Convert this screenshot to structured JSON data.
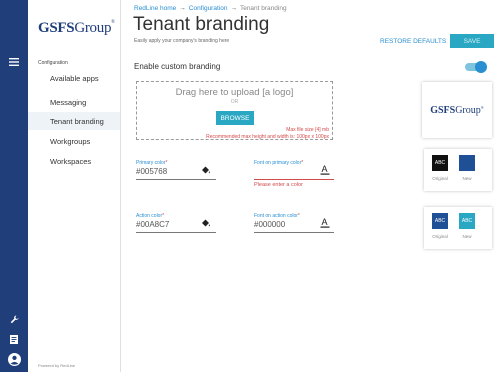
{
  "brand": {
    "logo_main": "GSFS",
    "logo_tail": "Group",
    "logo_mark": "®"
  },
  "nav": {
    "section": "Configuration",
    "items": [
      {
        "label": "Available apps",
        "active": false
      },
      {
        "label": "Messaging",
        "active": false
      },
      {
        "label": "Tenant branding",
        "active": true
      },
      {
        "label": "Workgroups",
        "active": false
      },
      {
        "label": "Workspaces",
        "active": false
      }
    ],
    "footer": "Powered by RedLine"
  },
  "breadcrumb": {
    "home": "RedLine home",
    "sep1": "→",
    "section": "Configuration",
    "sep2": "→",
    "current": "Tenant branding"
  },
  "header": {
    "title": "Tenant branding",
    "subtitle": "Easily apply your company's branding here",
    "restore_label": "RESTORE DEFAULTS",
    "save_label": "SAVE"
  },
  "enable": {
    "label": "Enable custom branding",
    "on": true
  },
  "upload": {
    "drag_text": "Drag here to upload [a logo]",
    "or_text": "OR",
    "browse_label": "BROWSE",
    "max_size": "Max file size [4] mb",
    "recommend": "Recommended max height and width is: 100px x 100px"
  },
  "fields": {
    "primary_color": {
      "label": "Primary color",
      "req": "*",
      "value": "#005768"
    },
    "font_on_primary": {
      "label": "Font on primary color",
      "req": "*",
      "value": "",
      "error": "Please enter a color"
    },
    "action_color": {
      "label": "Action color",
      "req": "*",
      "value": "#00A8C7"
    },
    "font_on_action": {
      "label": "Font on action color",
      "req": "*",
      "value": "#000000"
    }
  },
  "previews": {
    "primary": {
      "abc": "ABC",
      "original_label": "Original",
      "new_label": "New",
      "original_color": "#111111",
      "new_color": "#1f4f94"
    },
    "action": {
      "abc": "ABC",
      "original_label": "Original",
      "new_label": "New",
      "original_color": "#1f4f94",
      "new_color": "#2aa8c3"
    }
  },
  "colors": {
    "rail": "#1f3e7a",
    "accent": "#2a8fd1",
    "button": "#2aa8c3",
    "error": "#d34a4a"
  },
  "icons": [
    "menu-icon",
    "wrench-icon",
    "document-icon",
    "user-icon",
    "paint-bucket-icon",
    "text-color-icon"
  ]
}
